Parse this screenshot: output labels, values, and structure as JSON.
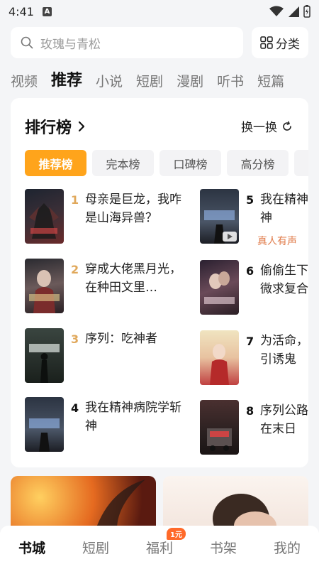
{
  "status": {
    "time": "4:41",
    "a_label": "A"
  },
  "search": {
    "placeholder": "玫瑰与青松",
    "category_label": "分类"
  },
  "tabs": [
    "视频",
    "推荐",
    "小说",
    "短剧",
    "漫剧",
    "听书",
    "短篇"
  ],
  "ranking": {
    "title": "排行榜",
    "refresh_label": "换一换",
    "tabs": [
      "推荐榜",
      "完本榜",
      "口碑榜",
      "高分榜"
    ],
    "books": [
      {
        "rank": "1",
        "title": "母亲是巨龙，我咋是山海异兽？"
      },
      {
        "rank": "2",
        "title": "穿成大佬黑月光，在种田文里…"
      },
      {
        "rank": "3",
        "title": "序列：吃神者"
      },
      {
        "rank": "4",
        "title": "我在精神病院学斩神"
      },
      {
        "rank": "5",
        "title": "我在精神病院学斩神",
        "tag": "真人有声"
      },
      {
        "rank": "6",
        "title": "偷偷生下太子爷卑微求复合"
      },
      {
        "rank": "7",
        "title": "为活命，我在神庙引诱鬼"
      },
      {
        "rank": "8",
        "title": "序列公路求生：我在末日"
      }
    ]
  },
  "bottom_nav": {
    "items": [
      "书城",
      "短剧",
      "福利",
      "书架",
      "我的"
    ],
    "badge": "1元"
  },
  "colors": {
    "accent": "#ffa41b",
    "rank_gold": "#e0a85b",
    "badge": "#ff6a2a"
  }
}
